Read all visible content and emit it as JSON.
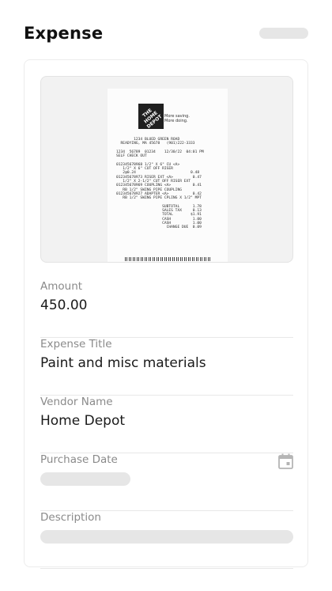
{
  "header": {
    "title": "Expense"
  },
  "receipt": {
    "store_name": "THE HOME DEPOT",
    "tagline": "More saving.\nMore doing.",
    "lines": "        1234 BLUED GREEN ROAD\n  READYING, MA 45678   (901)222-3333\n\n1234  56789  01234    12/30/22  04:01 PM\nSELF CHECK OUT\n\n012345678968 1/2\" X 6\" CU <A>\n   1/2\" X 6\" CUT OFF RISER\n   2@0.24                         0.48\n012345678973 RISER EXT <A>         0.47\n   1/2\" X 2-1/2\" CUT OFF RISER EXT\n012345678969 COUPLING <A>          0.41\n   RB 1/2\" SWING PIPE COUPLING\n012345678927 ADAPTER <A>           0.42\n   RB 1/2\" SWING PIPE CPLING X 1/2\" MPT\n\n                     SUBTOTAL      1.78\n                     SALES TAX     0.13\n                     TOTAL        $1.91\n                     CASH          1.00\n                     CASH          1.00\n                       CHANGE DUE  0.09"
  },
  "fields": {
    "amount": {
      "label": "Amount",
      "value": "450.00"
    },
    "expense_title": {
      "label": "Expense Title",
      "value": "Paint and misc materials"
    },
    "vendor_name": {
      "label": "Vendor Name",
      "value": "Home Depot"
    },
    "purchase_date": {
      "label": "Purchase Date",
      "icon": "calendar-icon"
    },
    "description": {
      "label": "Description"
    }
  },
  "colors": {
    "skeleton": "#e6e6e6",
    "label": "#8a8a8a",
    "icon": "#b5b5b5"
  }
}
